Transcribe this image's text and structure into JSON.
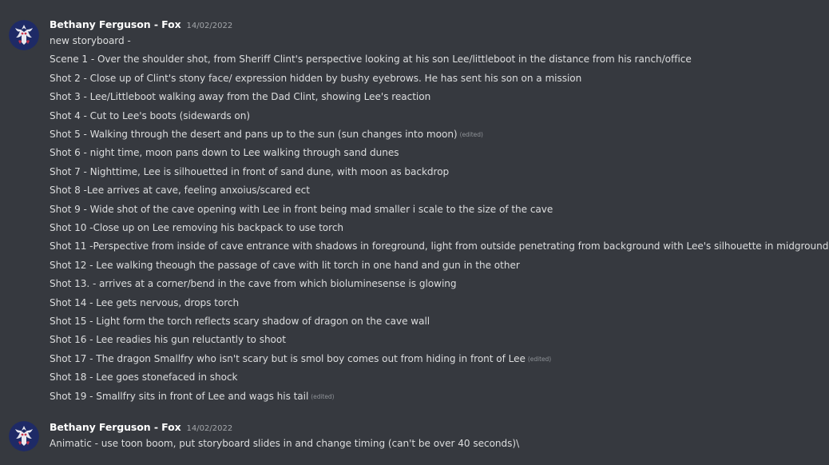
{
  "messages": [
    {
      "author": "Bethany Ferguson - Fox",
      "timestamp": "14/02/2022",
      "avatar_icon": "dragon-avatar-icon",
      "lines": [
        {
          "text": "new storyboard -",
          "edited": ""
        },
        {
          "text": "Scene 1 - Over the shoulder shot, from Sheriff Clint's perspective looking at  his son Lee/littleboot in the distance from his ranch/office",
          "edited": ""
        },
        {
          "text": "Shot 2 - Close up of Clint's stony face/ expression hidden by bushy eyebrows. He has sent his son on a mission",
          "edited": ""
        },
        {
          "text": "Shot 3 - Lee/Littleboot walking away from the Dad Clint, showing Lee's reaction",
          "edited": ""
        },
        {
          "text": "Shot 4 - Cut to Lee's boots (sidewards on)",
          "edited": ""
        },
        {
          "text": "Shot 5 - Walking through the desert and pans up to the sun (sun changes into moon)",
          "edited": "(edited)"
        },
        {
          "text": "Shot 6 - night time, moon pans down to Lee walking through sand dunes",
          "edited": ""
        },
        {
          "text": "Shot 7 - Nighttime, Lee is silhouetted in front of sand dune, with moon as backdrop",
          "edited": ""
        },
        {
          "text": "Shot 8 -Lee arrives at cave, feeling anxoius/scared ect",
          "edited": ""
        },
        {
          "text": "Shot 9 - Wide shot of the cave opening with Lee in front being mad smaller i scale to the size of the cave",
          "edited": ""
        },
        {
          "text": "Shot 10 -Close up on Lee removing his backpack to use torch",
          "edited": ""
        },
        {
          "text": "Shot 11 -Perspective from inside of cave entrance with shadows in foreground, light from outside penetrating from background with Lee's silhouette in midground",
          "edited": ""
        },
        {
          "text": "Shot 12 - Lee walking theough the passage of cave with lit torch in one hand and gun in the other",
          "edited": ""
        },
        {
          "text": "Shot 13. - arrives at a corner/bend in the cave from which bioluminesense is glowing",
          "edited": ""
        },
        {
          "text": "Shot 14 - Lee gets nervous, drops torch",
          "edited": ""
        },
        {
          "text": "Shot 15 - Light form the torch reflects scary shadow of dragon on the cave wall",
          "edited": ""
        },
        {
          "text": "Shot 16 - Lee readies his gun reluctantly to shoot",
          "edited": ""
        },
        {
          "text": "Shot 17 - The dragon Smallfry who isn't scary but is smol boy comes out from hiding in front of Lee",
          "edited": "(edited)"
        },
        {
          "text": "Shot 18 - Lee goes stonefaced in shock",
          "edited": ""
        },
        {
          "text": "Shot 19 - Smallfry sits in front of Lee and wags his tail",
          "edited": "(edited)"
        }
      ]
    },
    {
      "author": "Bethany Ferguson - Fox",
      "timestamp": "14/02/2022",
      "avatar_icon": "dragon-avatar-icon",
      "lines": [
        {
          "text": "Animatic - use toon boom, put storyboard slides in and change timing (can't be over 40 seconds)\\",
          "edited": ""
        }
      ]
    }
  ],
  "colors": {
    "background": "#36393f",
    "username": "#ffffff",
    "text": "#dcddde",
    "timestamp": "#a3a6aa",
    "avatar_bg": "#1e2a66"
  }
}
